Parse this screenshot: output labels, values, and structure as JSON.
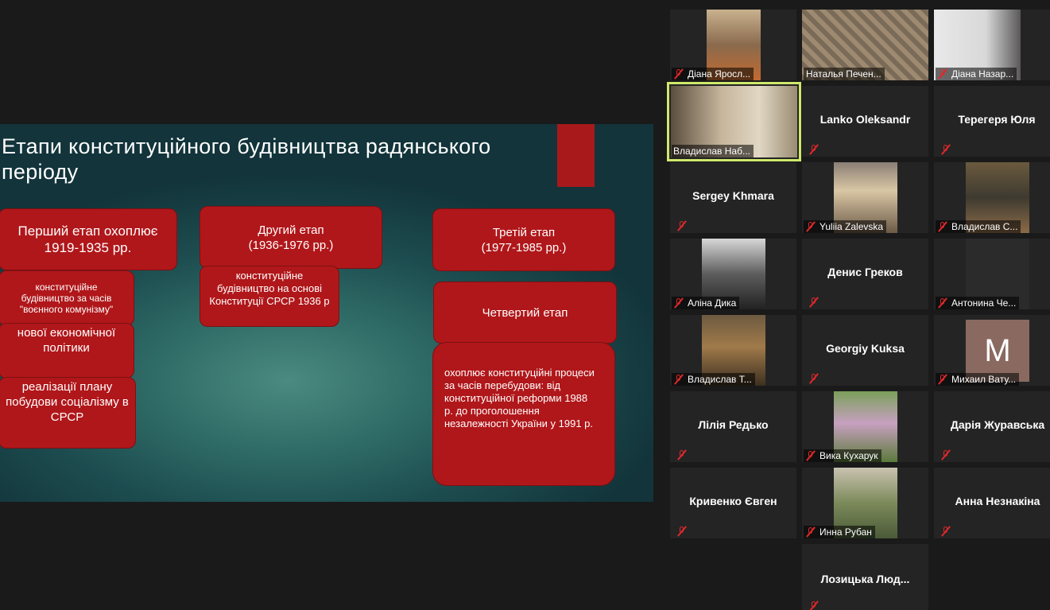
{
  "slide": {
    "title": "Етапи конституційного будівництва радянського періоду",
    "boxes": {
      "stage1": "Перший етап охоплює 1919-1935 рр.",
      "stage1_item1": "конституційне будівництво за часів \"воєнного комунізму\"",
      "stage1_item2": "нової економічної політики",
      "stage1_item3": "реалізації плану побудови соціалізму в СРСР",
      "stage2": "Другий етап (1936-1976 рр.)",
      "stage2_item1": "конституційне будівництво на основі Конституції СРСР 1936 р",
      "stage3": "Третій етап (1977-1985 рр.)",
      "stage4": "Четвертий етап",
      "stage4_item1": "охоплює конституційні процеси за часів перебудови: від конституційної реформи 1988 р. до проголошення незалежності України у 1991 р."
    },
    "accent_color": "#a8191c",
    "box_color": "#b0171a"
  },
  "participants": [
    {
      "name": "Діана Яросл...",
      "video": true,
      "muted": true
    },
    {
      "name": "Наталья Печен...",
      "video": true,
      "muted": false
    },
    {
      "name": "Діана Назар...",
      "video": true,
      "muted": true
    },
    {
      "name": "Владислав Наб...",
      "video": true,
      "muted": false,
      "active_speaker": true
    },
    {
      "name": "Lanko Oleksandr",
      "video": false,
      "muted": true
    },
    {
      "name": "Терегеря Юля",
      "video": false,
      "muted": true
    },
    {
      "name": "Sergey Khmara",
      "video": false,
      "muted": true
    },
    {
      "name": "Yuliia Zalevska",
      "video": true,
      "muted": true
    },
    {
      "name": "Владислав С...",
      "video": true,
      "muted": true
    },
    {
      "name": "Аліна Дика",
      "video": true,
      "muted": true
    },
    {
      "name": "Денис Греков",
      "video": false,
      "muted": true
    },
    {
      "name": "Антонина Че...",
      "video": true,
      "muted": true
    },
    {
      "name": "Владислав Т...",
      "video": true,
      "muted": true
    },
    {
      "name": "Georgiy Kuksa",
      "video": false,
      "muted": true
    },
    {
      "name": "Михаил Вату...",
      "video": false,
      "muted": true,
      "avatar_letter": "M"
    },
    {
      "name": "Лілія Редько",
      "video": false,
      "muted": true
    },
    {
      "name": "Вика Кухарук",
      "video": true,
      "muted": true
    },
    {
      "name": "Дарія Журавська",
      "video": false,
      "muted": true
    },
    {
      "name": "Кривенко Євген",
      "video": false,
      "muted": true
    },
    {
      "name": "Инна Рубан",
      "video": true,
      "muted": true
    },
    {
      "name": "Анна Незнакіна",
      "video": false,
      "muted": true
    },
    {
      "name": "Лозицька  Люд...",
      "video": false,
      "muted": true
    }
  ],
  "colors": {
    "active_speaker_border": "#cfe86a",
    "muted_icon": "#e0282a",
    "background": "#1a1a1a",
    "tile_background": "#242424"
  },
  "icons": [
    "mic-muted-icon"
  ]
}
